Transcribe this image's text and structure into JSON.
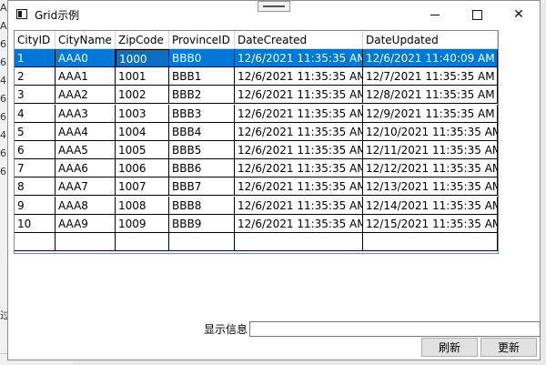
{
  "window": {
    "title": "Grid示例"
  },
  "background_fragments": {
    "chars": [
      "A",
      "A",
      "6",
      "6",
      "4",
      "6",
      "6",
      "4",
      "6",
      "6",
      "过"
    ]
  },
  "grid": {
    "columns": [
      "CityID",
      "CityName",
      "ZipCode",
      "ProvinceID",
      "DateCreated",
      "DateUpdated"
    ],
    "rows": [
      [
        "1",
        "AAA0",
        "1000",
        "BBB0",
        "12/6/2021 11:35:35 AM",
        "12/6/2021 11:40:09 AM"
      ],
      [
        "2",
        "AAA1",
        "1001",
        "BBB1",
        "12/6/2021 11:35:35 AM",
        "12/7/2021 11:35:35 AM"
      ],
      [
        "3",
        "AAA2",
        "1002",
        "BBB2",
        "12/6/2021 11:35:35 AM",
        "12/8/2021 11:35:35 AM"
      ],
      [
        "4",
        "AAA3",
        "1003",
        "BBB3",
        "12/6/2021 11:35:35 AM",
        "12/9/2021 11:35:35 AM"
      ],
      [
        "5",
        "AAA4",
        "1004",
        "BBB4",
        "12/6/2021 11:35:35 AM",
        "12/10/2021 11:35:35 AM"
      ],
      [
        "6",
        "AAA5",
        "1005",
        "BBB5",
        "12/6/2021 11:35:35 AM",
        "12/11/2021 11:35:35 AM"
      ],
      [
        "7",
        "AAA6",
        "1006",
        "BBB6",
        "12/6/2021 11:35:35 AM",
        "12/12/2021 11:35:35 AM"
      ],
      [
        "8",
        "AAA7",
        "1007",
        "BBB7",
        "12/6/2021 11:35:35 AM",
        "12/13/2021 11:35:35 AM"
      ],
      [
        "9",
        "AAA8",
        "1008",
        "BBB8",
        "12/6/2021 11:35:35 AM",
        "12/14/2021 11:35:35 AM"
      ],
      [
        "10",
        "AAA9",
        "1009",
        "BBB9",
        "12/6/2021 11:35:35 AM",
        "12/15/2021 11:35:35 AM"
      ],
      [
        "",
        "",
        "",
        "",
        "",
        ""
      ]
    ],
    "selected_row": 0,
    "current_cell_column": 2
  },
  "info": {
    "label": "显示信息",
    "value": ""
  },
  "buttons": {
    "refresh": "刷新",
    "update": "更新"
  },
  "colors": {
    "selection": "#0078d7",
    "grid_border": "#6c8ebf"
  }
}
